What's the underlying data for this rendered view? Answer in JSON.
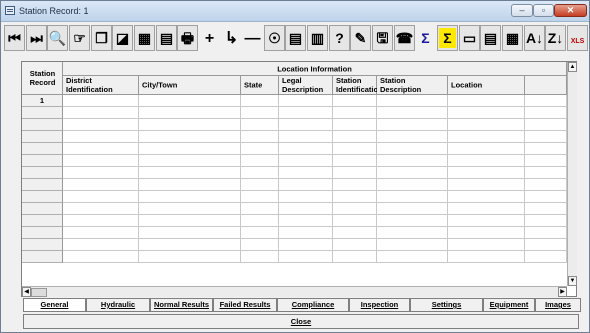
{
  "window": {
    "title": "Station Record: 1",
    "min_icon": "–",
    "max_icon": "▫",
    "close_icon": "✕"
  },
  "toolbar": {
    "buttons": [
      {
        "name": "first-record-icon",
        "glyph": "⏮"
      },
      {
        "name": "last-record-icon",
        "glyph": "⏭"
      },
      {
        "name": "search-icon",
        "glyph": "🔍"
      },
      {
        "name": "pointer-icon",
        "glyph": "☞"
      },
      {
        "name": "copy-icon",
        "glyph": "❐"
      },
      {
        "name": "eraser-icon",
        "glyph": "◪"
      },
      {
        "name": "grid-icon",
        "glyph": "▦"
      },
      {
        "name": "table-icon",
        "glyph": "▤"
      },
      {
        "name": "print-icon",
        "glyph": "🖶"
      },
      {
        "name": "add-icon",
        "glyph": "+"
      },
      {
        "name": "insert-icon",
        "glyph": "↳"
      },
      {
        "name": "remove-icon",
        "glyph": "—"
      },
      {
        "name": "hydrant-icon",
        "glyph": "☉"
      },
      {
        "name": "report-icon",
        "glyph": "▤"
      },
      {
        "name": "form-icon",
        "glyph": "▥"
      },
      {
        "name": "help-notes-icon",
        "glyph": "?"
      },
      {
        "name": "edit-notes-icon",
        "glyph": "✎"
      },
      {
        "name": "save-icon",
        "glyph": "🖫"
      },
      {
        "name": "phone-icon",
        "glyph": "☎"
      },
      {
        "name": "sum-icon",
        "glyph": "Σ"
      },
      {
        "name": "sum-all-icon",
        "glyph": "Σ"
      },
      {
        "name": "window-icon",
        "glyph": "▭"
      },
      {
        "name": "list-window-icon",
        "glyph": "▤"
      },
      {
        "name": "calc-icon",
        "glyph": "▦"
      },
      {
        "name": "sort-asc-icon",
        "glyph": "A↓"
      },
      {
        "name": "sort-desc-icon",
        "glyph": "Z↓"
      },
      {
        "name": "excel-icon",
        "glyph": "XLS"
      }
    ]
  },
  "grid": {
    "group_header": "Location Information",
    "row_header": "Station Record",
    "columns": [
      "District Identification",
      "City/Town",
      "State",
      "Legal Description",
      "Station Identification",
      "Station Description",
      "Location"
    ],
    "rows": [
      "1",
      "",
      "",
      "",
      "",
      "",
      "",
      "",
      "",
      "",
      "",
      "",
      "",
      ""
    ]
  },
  "scroll": {
    "up": "▲",
    "down": "▼",
    "left": "◀",
    "right": "▶"
  },
  "tabs": [
    {
      "label": "General",
      "active": true
    },
    {
      "label": "Hydraulic",
      "active": false
    },
    {
      "label": "Normal Results",
      "active": false
    },
    {
      "label": "Failed Results",
      "active": false
    },
    {
      "label": "Compliance",
      "active": false
    },
    {
      "label": "Inspection",
      "active": false
    },
    {
      "label": "Settings",
      "active": false
    },
    {
      "label": "Equipment",
      "active": false
    },
    {
      "label": "Images",
      "active": false
    }
  ],
  "close_button": "Close"
}
